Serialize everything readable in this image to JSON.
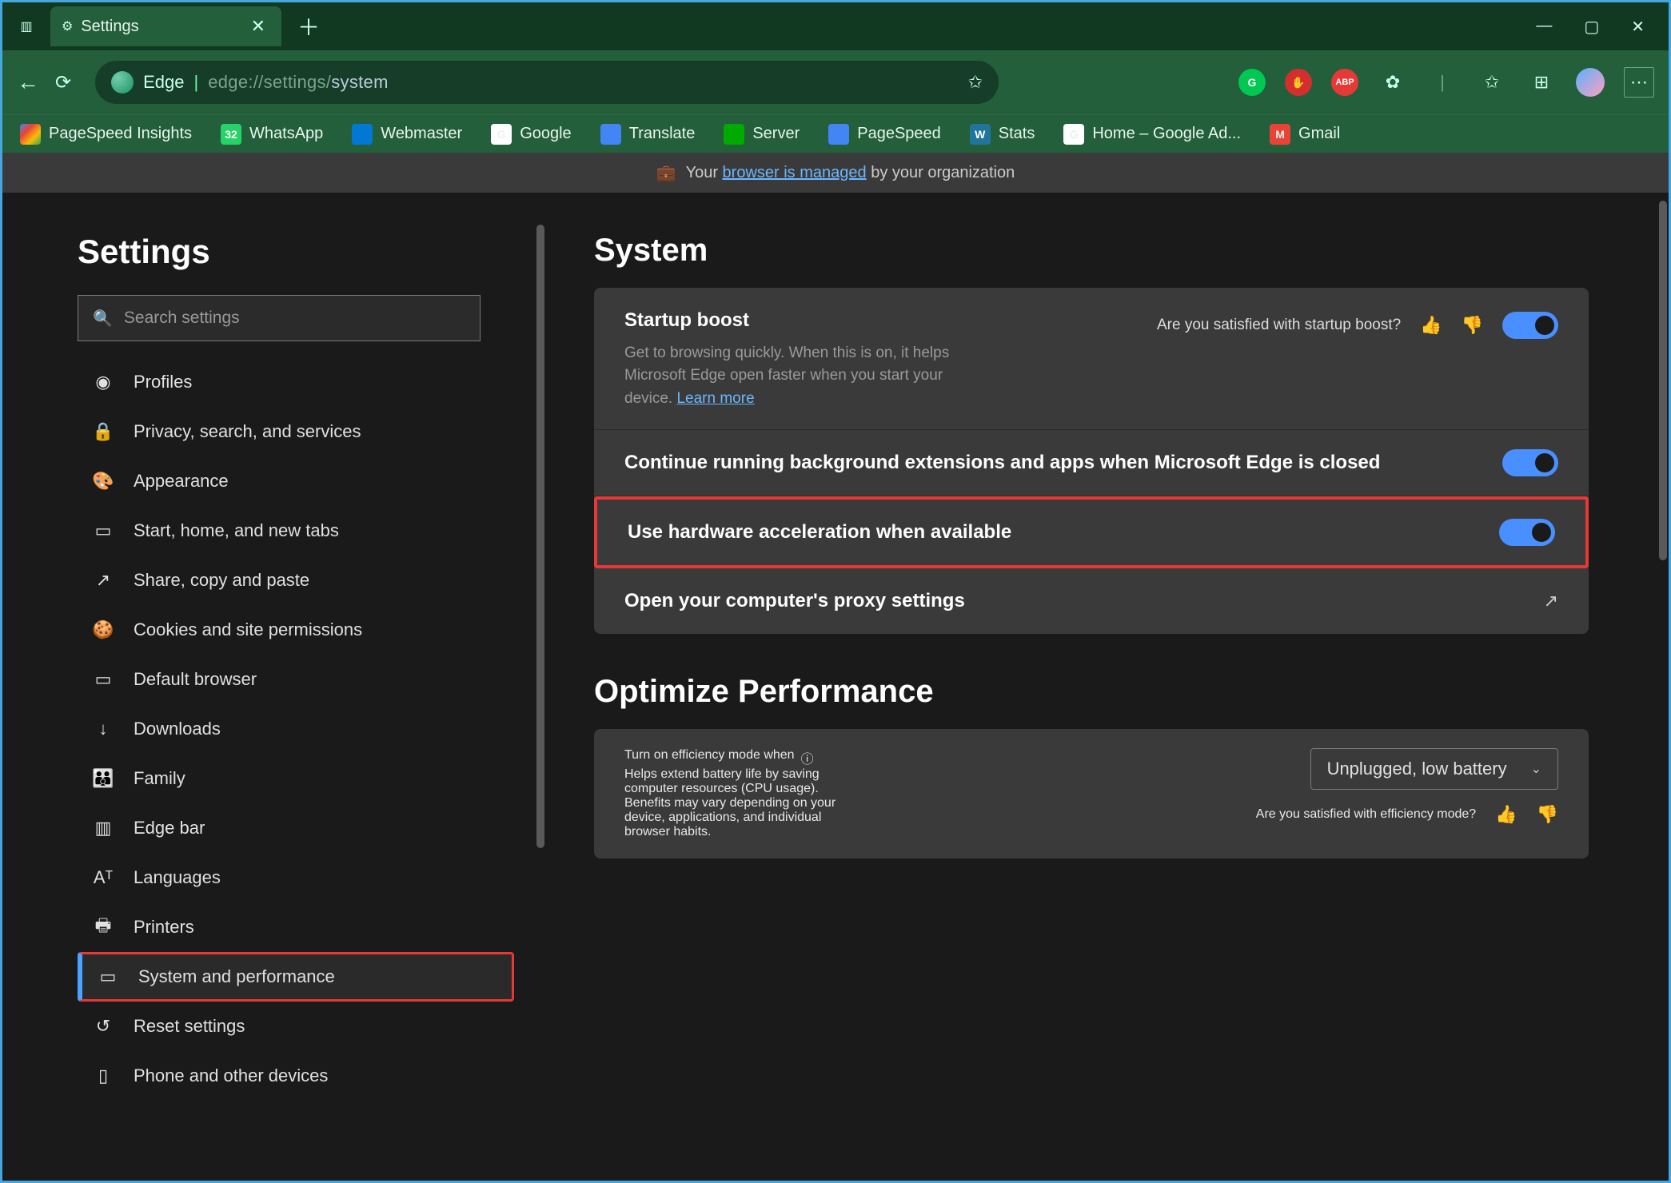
{
  "window": {
    "tab_label": "Settings"
  },
  "addressbar": {
    "brand": "Edge",
    "url_prefix": "edge://settings/",
    "url_page": "system"
  },
  "tool_icons": {
    "grammarly": "G",
    "abp": "ABP"
  },
  "bookmarks": [
    {
      "label": "PageSpeed Insights",
      "cls": "psi"
    },
    {
      "label": "WhatsApp",
      "cls": "wa",
      "badge": "32"
    },
    {
      "label": "Webmaster",
      "cls": "wm"
    },
    {
      "label": "Google",
      "cls": "gg",
      "badge": "G"
    },
    {
      "label": "Translate",
      "cls": "tr"
    },
    {
      "label": "Server",
      "cls": "sv"
    },
    {
      "label": "PageSpeed",
      "cls": "ps2"
    },
    {
      "label": "Stats",
      "cls": "wp",
      "badge": "W"
    },
    {
      "label": "Home – Google Ad...",
      "cls": "ha",
      "badge": "G"
    },
    {
      "label": "Gmail",
      "cls": "gm",
      "badge": "M"
    }
  ],
  "managed": {
    "pre": "Your ",
    "link": "browser is managed",
    "post": " by your organization"
  },
  "sidebar": {
    "title": "Settings",
    "search_placeholder": "Search settings",
    "items": [
      {
        "icon": "◉",
        "label": "Profiles"
      },
      {
        "icon": "🔒",
        "label": "Privacy, search, and services"
      },
      {
        "icon": "🎨",
        "label": "Appearance"
      },
      {
        "icon": "▭",
        "label": "Start, home, and new tabs"
      },
      {
        "icon": "↗",
        "label": "Share, copy and paste"
      },
      {
        "icon": "🍪",
        "label": "Cookies and site permissions"
      },
      {
        "icon": "▭",
        "label": "Default browser"
      },
      {
        "icon": "↓",
        "label": "Downloads"
      },
      {
        "icon": "👪",
        "label": "Family"
      },
      {
        "icon": "▥",
        "label": "Edge bar"
      },
      {
        "icon": "Aᵀ",
        "label": "Languages"
      },
      {
        "icon": "🖶",
        "label": "Printers"
      },
      {
        "icon": "▭",
        "label": "System and performance",
        "selected": true
      },
      {
        "icon": "↺",
        "label": "Reset settings"
      },
      {
        "icon": "▯",
        "label": "Phone and other devices"
      }
    ]
  },
  "main": {
    "system_heading": "System",
    "startup": {
      "title": "Startup boost",
      "desc": "Get to browsing quickly. When this is on, it helps Microsoft Edge open faster when you start your device. ",
      "learn": "Learn more",
      "feedback": "Are you satisfied with startup boost?"
    },
    "bg_apps": "Continue running background extensions and apps when Microsoft Edge is closed",
    "hw_accel": "Use hardware acceleration when available",
    "proxy": "Open your computer's proxy settings",
    "perf_heading": "Optimize Performance",
    "efficiency": {
      "title": "Turn on efficiency mode when",
      "desc": "Helps extend battery life by saving computer resources (CPU usage). Benefits may vary depending on your device, applications, and individual browser habits.",
      "dropdown": "Unplugged, low battery",
      "feedback": "Are you satisfied with efficiency mode?"
    }
  }
}
